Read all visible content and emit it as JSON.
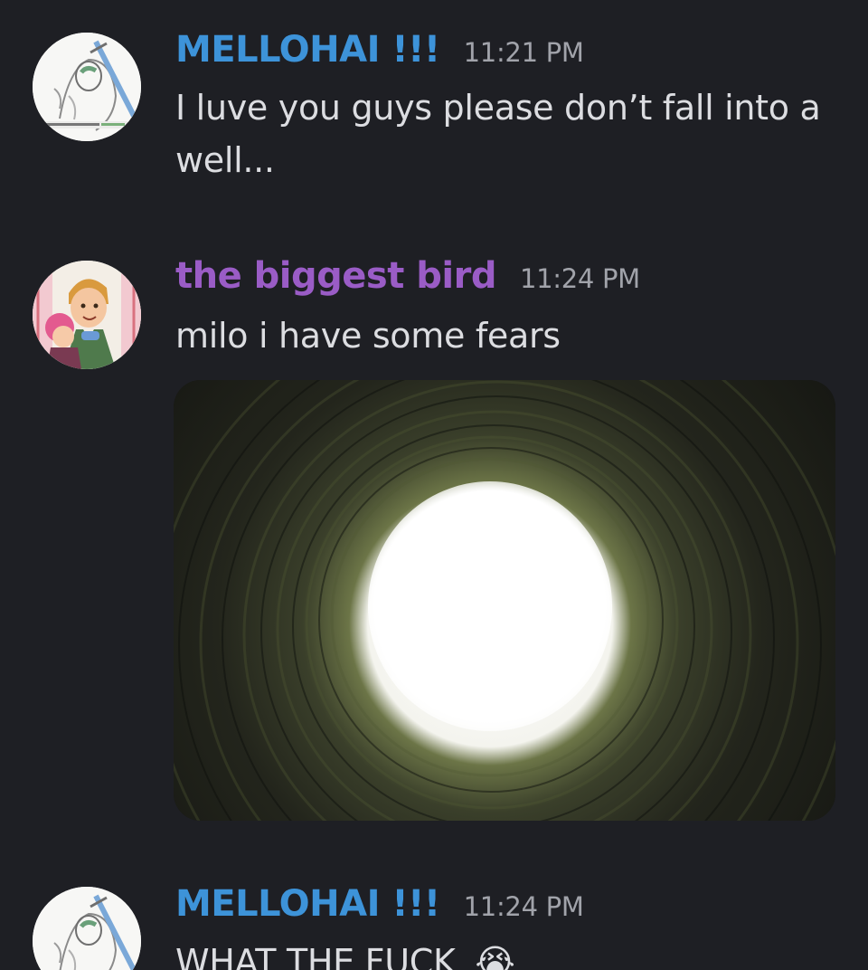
{
  "theme": {
    "background": "#1e1f24",
    "author_blue": "#3d93d9",
    "author_purple": "#9a5cc6",
    "timestamp_gray": "#a1a3aa"
  },
  "messages": [
    {
      "author": "MELLOHAI !!!",
      "time": "11:21 PM",
      "text": "I luve you guys please don’t fall into a well...",
      "avatar": "sketch-swordsman-avatar"
    },
    {
      "author": "the biggest bird",
      "time": "11:24 PM",
      "text": "milo i have some fears",
      "avatar": "cartoon-duo-avatar",
      "attachment": "image looking up from the bottom of a well"
    },
    {
      "author": "MELLOHAI !!!",
      "time": "11:24 PM",
      "text": "WHAT THE FUCK",
      "emoji": "😭",
      "avatar": "sketch-swordsman-avatar"
    }
  ]
}
